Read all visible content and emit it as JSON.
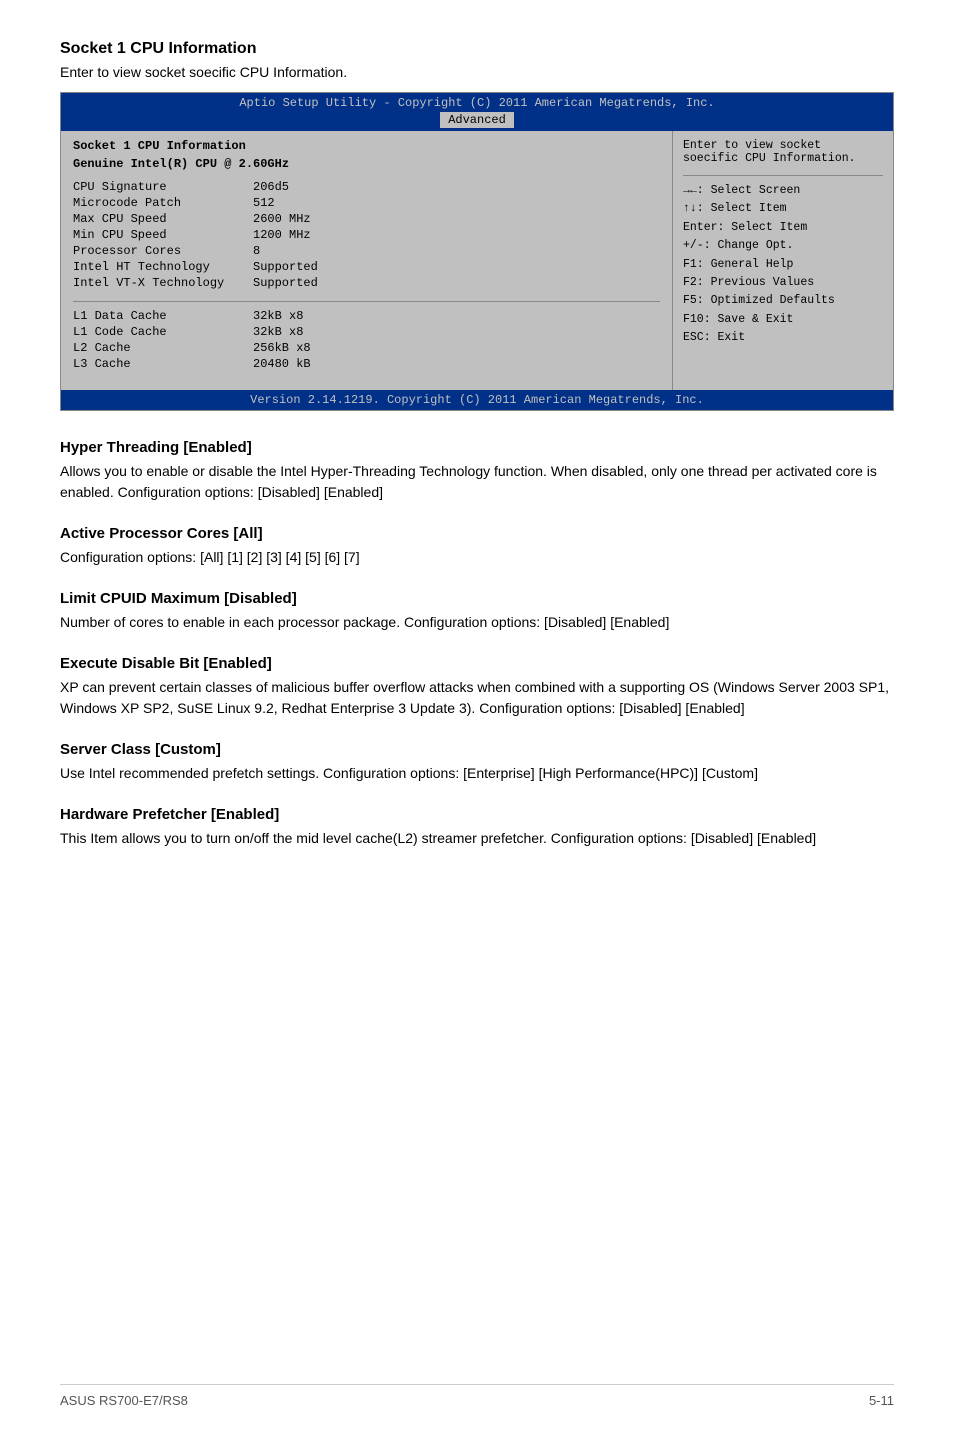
{
  "page": {
    "main_title": "Socket 1 CPU Information",
    "main_desc": "Enter to view socket soecific CPU Information.",
    "bios": {
      "header_text": "Aptio Setup Utility - Copyright (C) 2011 American Megatrends, Inc.",
      "tab_label": "Advanced",
      "section_title": "Socket 1 CPU Information",
      "subtitle": "Genuine Intel(R) CPU @ 2.60GHz",
      "rows": [
        {
          "label": "CPU Signature",
          "value": "206d5"
        },
        {
          "label": "Microcode Patch",
          "value": "512"
        },
        {
          "label": "Max CPU Speed",
          "value": "2600 MHz"
        },
        {
          "label": "Min CPU Speed",
          "value": "1200 MHz"
        },
        {
          "label": "Processor Cores",
          "value": "8"
        },
        {
          "label": "Intel HT Technology",
          "value": "Supported"
        },
        {
          "label": "Intel VT-X Technology",
          "value": "Supported"
        }
      ],
      "cache_rows": [
        {
          "label": "L1 Data Cache",
          "value": "32kB x8"
        },
        {
          "label": "L1 Code Cache",
          "value": "32kB x8"
        },
        {
          "label": "L2 Cache",
          "value": "256kB x8"
        },
        {
          "label": "L3 Cache",
          "value": "20480 kB"
        }
      ],
      "right_help_top": "Enter to view socket soecific CPU Information.",
      "right_nav": [
        "→←: Select Screen",
        "↑↓:  Select Item",
        "Enter: Select Item",
        "+/-: Change Opt.",
        "F1: General Help",
        "F2: Previous Values",
        "F5: Optimized Defaults",
        "F10: Save & Exit",
        "ESC: Exit"
      ],
      "footer_text": "Version 2.14.1219. Copyright (C) 2011 American Megatrends, Inc."
    },
    "sections": [
      {
        "title": "Hyper Threading [Enabled]",
        "body": "Allows you to enable or disable the Intel Hyper-Threading Technology function. When disabled, only one thread per activated core is enabled. Configuration options: [Disabled] [Enabled]"
      },
      {
        "title": "Active Processor Cores [All]",
        "body": "Configuration options: [All] [1] [2] [3] [4] [5] [6] [7]"
      },
      {
        "title": "Limit CPUID Maximum [Disabled]",
        "body": "Number of cores to enable in each processor package. Configuration options: [Disabled] [Enabled]"
      },
      {
        "title": "Execute Disable Bit [Enabled]",
        "body": "XP can prevent certain classes of malicious buffer overflow attacks when combined with a supporting OS (Windows Server 2003 SP1, Windows XP SP2, SuSE Linux 9.2, Redhat Enterprise 3 Update 3). Configuration options: [Disabled] [Enabled]"
      },
      {
        "title": "Server Class [Custom]",
        "body": "Use Intel recommended prefetch settings. Configuration options: [Enterprise] [High Performance(HPC)] [Custom]"
      },
      {
        "title": "Hardware Prefetcher [Enabled]",
        "body": "This Item allows you to turn on/off the mid level cache(L2) streamer prefetcher. Configuration options: [Disabled] [Enabled]"
      }
    ],
    "footer": {
      "left": "ASUS RS700-E7/RS8",
      "right": "5-11"
    }
  }
}
